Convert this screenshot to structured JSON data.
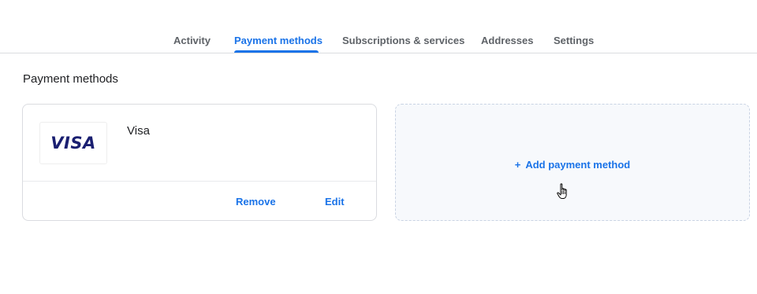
{
  "tabs": [
    {
      "label": "Activity",
      "active": false
    },
    {
      "label": "Payment methods",
      "active": true
    },
    {
      "label": "Subscriptions & services",
      "active": false
    },
    {
      "label": "Addresses",
      "active": false
    },
    {
      "label": "Settings",
      "active": false
    }
  ],
  "page": {
    "title": "Payment methods"
  },
  "card": {
    "logo_text": "VISA",
    "name": "Visa",
    "remove_label": "Remove",
    "edit_label": "Edit"
  },
  "add_method": {
    "plus": "+",
    "label": "Add payment method"
  },
  "colors": {
    "accent": "#1a73e8",
    "visa_blue": "#1a1f71",
    "divider": "#dadce0"
  },
  "icons": {
    "cursor": "hand-pointer-icon"
  }
}
